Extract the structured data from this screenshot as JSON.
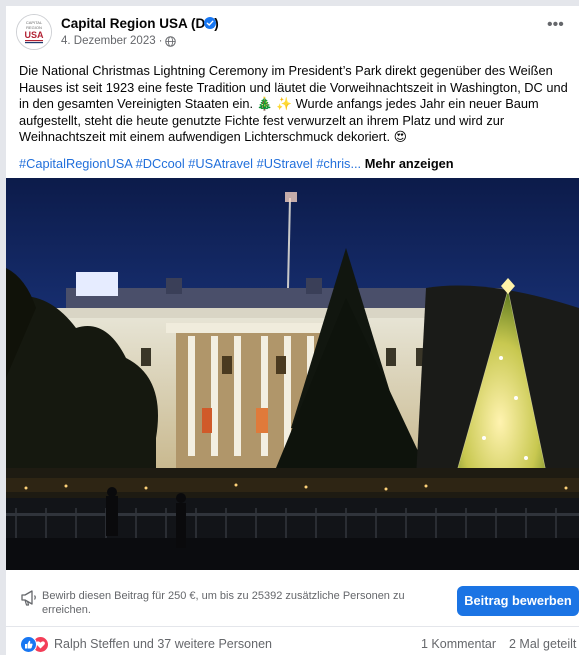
{
  "post": {
    "page_name": "Capital Region USA (DE)",
    "date": "4. Dezember 2023",
    "audience_icon": "globe-icon",
    "text": "Die National Christmas Lightning Ceremony im President’s Park direkt gegenüber des Weißen Hauses ist seit 1923 eine feste Tradition und läutet die Vorweihnachtszeit in Washington, DC und in den gesamten Vereinigten Staaten ein. 🎄 ✨ Wurde anfangs jedes Jahr ein neuer Baum aufgestellt, steht die heute genutzte Fichte fest verwurzelt an ihrem Platz und wird zur Weihnachtszeit mit einem aufwendigen Lichterschmuck dekoriert. 😍",
    "hashtags": "#CapitalRegionUSA #DCcool #USAtravel #UStravel #chris...",
    "see_more": "Mehr anzeigen",
    "avatar_logo_text": [
      "CAPITAL",
      "REGION",
      "USA"
    ]
  },
  "boost": {
    "text": "Bewirb diesen Beitrag für 250 €, um bis zu 25392 zusätzliche Personen zu erreichen.",
    "button_label": "Beitrag bewerben"
  },
  "stats": {
    "reaction_icons": [
      "like-icon",
      "love-icon"
    ],
    "reactors": "Ralph Steffen und 37 weitere Personen",
    "comments": "1 Kommentar",
    "shares": "2 Mal geteilt"
  },
  "colors": {
    "brand_blue": "#1b74e4",
    "hashtag_blue": "#216fdb",
    "secondary_text": "#65676b",
    "like_blue": "#1877f2",
    "love_red": "#f33e58"
  }
}
